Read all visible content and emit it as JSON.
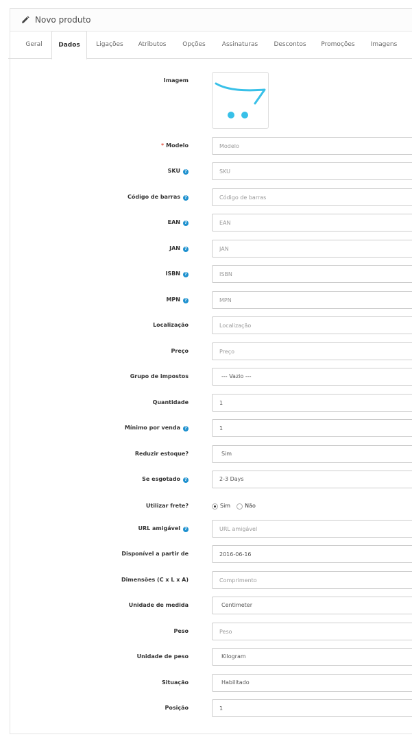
{
  "panel": {
    "title": "Novo produto",
    "icon": "pencil-icon"
  },
  "tabs": [
    {
      "label": "Geral"
    },
    {
      "label": "Dados",
      "active": true
    },
    {
      "label": "Ligações"
    },
    {
      "label": "Atributos"
    },
    {
      "label": "Opções"
    },
    {
      "label": "Assinaturas"
    },
    {
      "label": "Descontos"
    },
    {
      "label": "Promoções"
    },
    {
      "label": "Imagens"
    }
  ],
  "form": {
    "image": {
      "label": "Imagem",
      "logo_color": "#38c0e8"
    },
    "model": {
      "label": "Modelo",
      "required_mark": "*",
      "placeholder": "Modelo",
      "value": ""
    },
    "sku": {
      "label": "SKU",
      "placeholder": "SKU",
      "value": ""
    },
    "barcode": {
      "label": "Código de barras",
      "placeholder": "Código de barras",
      "value": ""
    },
    "ean": {
      "label": "EAN",
      "placeholder": "EAN",
      "value": ""
    },
    "jan": {
      "label": "JAN",
      "placeholder": "JAN",
      "value": ""
    },
    "isbn": {
      "label": "ISBN",
      "placeholder": "ISBN",
      "value": ""
    },
    "mpn": {
      "label": "MPN",
      "placeholder": "MPN",
      "value": ""
    },
    "location": {
      "label": "Localização",
      "placeholder": "Localização",
      "value": ""
    },
    "price": {
      "label": "Preço",
      "placeholder": "Preço",
      "value": ""
    },
    "tax_group": {
      "label": "Grupo de impostos",
      "selected": "--- Vazio ---"
    },
    "quantity": {
      "label": "Quantidade",
      "value": "1"
    },
    "minimum": {
      "label": "Mínimo por venda",
      "value": "1"
    },
    "subtract": {
      "label": "Reduzir estoque?",
      "selected": "Sim"
    },
    "out_of_stock": {
      "label": "Se esgotado",
      "selected": "2-3 Days"
    },
    "shipping": {
      "label": "Utilizar frete?",
      "options": [
        "Sim",
        "Não"
      ],
      "selected": "Sim"
    },
    "seo_url": {
      "label": "URL amigável",
      "placeholder": "URL amigável",
      "value": ""
    },
    "date_available": {
      "label": "Disponível a partir de",
      "value": "2016-06-16"
    },
    "dimensions": {
      "label": "Dimensões (C x L x A)",
      "placeholder": "Comprimento",
      "value": ""
    },
    "length_class": {
      "label": "Unidade de medida",
      "selected": "Centimeter"
    },
    "weight": {
      "label": "Peso",
      "placeholder": "Peso",
      "value": ""
    },
    "weight_class": {
      "label": "Unidade de peso",
      "selected": "Kilogram"
    },
    "status": {
      "label": "Situação",
      "selected": "Habilitado"
    },
    "sort_order": {
      "label": "Posição",
      "value": "1"
    }
  },
  "help_glyph": "?"
}
